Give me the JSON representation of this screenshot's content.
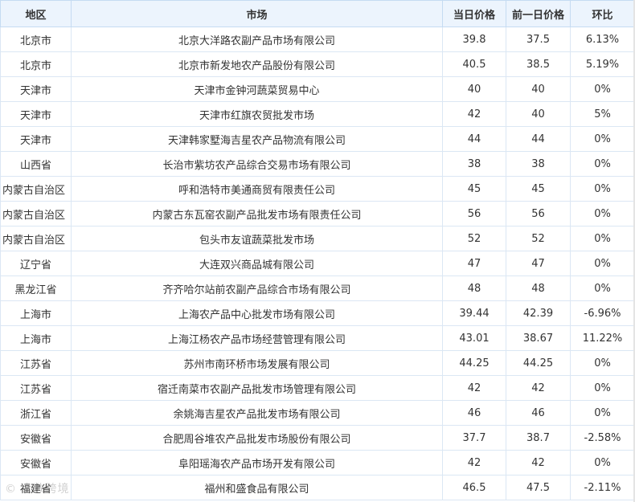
{
  "table": {
    "headers": {
      "region": "地区",
      "market": "市场",
      "today": "当日价格",
      "prev": "前一日价格",
      "ratio": "环比"
    },
    "rows": [
      {
        "region": "北京市",
        "market": "北京大洋路农副产品市场有限公司",
        "today": "39.8",
        "prev": "37.5",
        "ratio": "6.13%"
      },
      {
        "region": "北京市",
        "market": "北京市新发地农产品股份有限公司",
        "today": "40.5",
        "prev": "38.5",
        "ratio": "5.19%"
      },
      {
        "region": "天津市",
        "market": "天津市金钟河蔬菜贸易中心",
        "today": "40",
        "prev": "40",
        "ratio": "0%"
      },
      {
        "region": "天津市",
        "market": "天津市红旗农贸批发市场",
        "today": "42",
        "prev": "40",
        "ratio": "5%"
      },
      {
        "region": "天津市",
        "market": "天津韩家墅海吉星农产品物流有限公司",
        "today": "44",
        "prev": "44",
        "ratio": "0%"
      },
      {
        "region": "山西省",
        "market": "长治市紫坊农产品综合交易市场有限公司",
        "today": "38",
        "prev": "38",
        "ratio": "0%"
      },
      {
        "region": "内蒙古自治区",
        "market": "呼和浩特市美通商贸有限责任公司",
        "today": "45",
        "prev": "45",
        "ratio": "0%"
      },
      {
        "region": "内蒙古自治区",
        "market": "内蒙古东瓦窑农副产品批发市场有限责任公司",
        "today": "56",
        "prev": "56",
        "ratio": "0%"
      },
      {
        "region": "内蒙古自治区",
        "market": "包头市友谊蔬菜批发市场",
        "today": "52",
        "prev": "52",
        "ratio": "0%"
      },
      {
        "region": "辽宁省",
        "market": "大连双兴商品城有限公司",
        "today": "47",
        "prev": "47",
        "ratio": "0%"
      },
      {
        "region": "黑龙江省",
        "market": "齐齐哈尔站前农副产品综合市场有限公司",
        "today": "48",
        "prev": "48",
        "ratio": "0%"
      },
      {
        "region": "上海市",
        "market": "上海农产品中心批发市场有限公司",
        "today": "39.44",
        "prev": "42.39",
        "ratio": "-6.96%"
      },
      {
        "region": "上海市",
        "market": "上海江杨农产品市场经营管理有限公司",
        "today": "43.01",
        "prev": "38.67",
        "ratio": "11.22%"
      },
      {
        "region": "江苏省",
        "market": "苏州市南环桥市场发展有限公司",
        "today": "44.25",
        "prev": "44.25",
        "ratio": "0%"
      },
      {
        "region": "江苏省",
        "market": "宿迁南菜市农副产品批发市场管理有限公司",
        "today": "42",
        "prev": "42",
        "ratio": "0%"
      },
      {
        "region": "浙江省",
        "market": "余姚海吉星农产品批发市场有限公司",
        "today": "46",
        "prev": "46",
        "ratio": "0%"
      },
      {
        "region": "安徽省",
        "market": "合肥周谷堆农产品批发市场股份有限公司",
        "today": "37.7",
        "prev": "38.7",
        "ratio": "-2.58%"
      },
      {
        "region": "安徽省",
        "market": "阜阳瑶海农产品市场开发有限公司",
        "today": "42",
        "prev": "42",
        "ratio": "0%"
      },
      {
        "region": "福建省",
        "market": "福州和盛食品有限公司",
        "today": "46.5",
        "prev": "47.5",
        "ratio": "-2.11%"
      }
    ]
  },
  "watermark": "© 大数跨境"
}
